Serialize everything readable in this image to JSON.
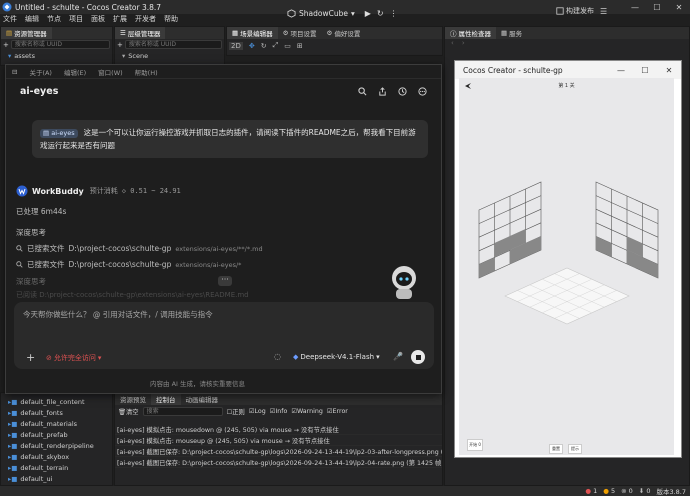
{
  "app": {
    "title": "Untitled - schulte - Cocos Creator 3.8.7",
    "menu": [
      "文件",
      "编辑",
      "节点",
      "项目",
      "面板",
      "扩展",
      "开发者",
      "帮助"
    ],
    "scene_name": "ShadowCube",
    "build_label": "构建发布"
  },
  "assets_panel": {
    "tab": "资源管理器",
    "search_placeholder": "搜索名称或 UUID",
    "root": "assets"
  },
  "hierarchy_panel": {
    "tab": "层级管理器",
    "search_placeholder": "搜索名称或 UUID",
    "root": "Scene"
  },
  "scene_panel": {
    "tabs": [
      "场景编辑器",
      "项目设置",
      "偏好设置"
    ],
    "mode_2d": "2D"
  },
  "inspector_panel": {
    "tabs": [
      "属性检查器",
      "服务"
    ]
  },
  "dialog": {
    "menu": [
      "关于(A)",
      "编辑(E)",
      "窗口(W)",
      "帮助(H)"
    ],
    "title": "ai-eyes",
    "prompt_chip": "ai-eyes",
    "prompt_text": "这是一个可以让你运行操控游戏并抓取日志的插件，请阅读下插件的README之后，帮我看下目前游戏运行起来是否有问题",
    "agent_name": "WorkBuddy",
    "cost_label": "预计消耗",
    "cost_value": "◇ 0.51 ~ 24.91",
    "elapsed": "已处理 6m44s",
    "section": "深度思考",
    "search1_label": "已搜索文件",
    "search1_path": "D:\\project-cocos\\schulte-gp",
    "search1_glob": "extensions/ai-eyes/**/*.md",
    "search2_label": "已搜索文件",
    "search2_path": "D:\\project-cocos\\schulte-gp",
    "search2_glob": "extensions/ai-eyes/*",
    "section2": "深度思考",
    "faded_line": "已阅读 D:\\project-cocos\\schulte-gp\\extensions\\ai-eyes\\README.md",
    "input_placeholder": "今天帮你做些什么？ @ 引用对话文件，/ 调用技能与指令",
    "access_label": "允许完全访问",
    "model": "Deepseek-V4.1-Flash",
    "footnote": "内容由 AI 生成，请核实重要信息"
  },
  "asset_tree": [
    "default_file_content",
    "default_fonts",
    "default_materials",
    "default_prefab",
    "default_renderpipeline",
    "default_skybox",
    "default_terrain",
    "default_ui"
  ],
  "console": {
    "tabs": [
      "资源预览",
      "控制台",
      "动画编辑器"
    ],
    "clear_label": "清空",
    "search_placeholder": "搜索",
    "filters": [
      "正则",
      "Log",
      "Info",
      "Warning",
      "Error"
    ],
    "lines": [
      "[ai-eyes] 模拟点击: mousedown @ (245, 505) via mouse → 没有节点接住",
      "[ai-eyes] 模拟点击: mouseup @ (245, 505) via mouse → 没有节点接住",
      "[ai-eyes] 截图已保存: D:\\project-cocos\\schulte-gp\\logs\\2026-09-24-13-44-19\\lp2-03-after-longpress.png (第 13",
      "[ai-eyes] 截图已保存: D:\\project-cocos\\schulte-gp\\logs\\2026-09-24-13-44-19\\lp2-04-rate.png (第 1425 帧, 487"
    ]
  },
  "status": {
    "errors": "1",
    "warnings": "5",
    "others": "0",
    "messages": "0",
    "version": "版本3.8.7"
  },
  "preview": {
    "title": "Cocos Creator - schulte-gp",
    "level": "第 1 关",
    "btn_left": "开始 0",
    "btn_mid": "重置",
    "btn_right": "提示"
  },
  "colors": {
    "accent": "#f0a000",
    "danger": "#e05252",
    "link": "#4a8fd8"
  }
}
